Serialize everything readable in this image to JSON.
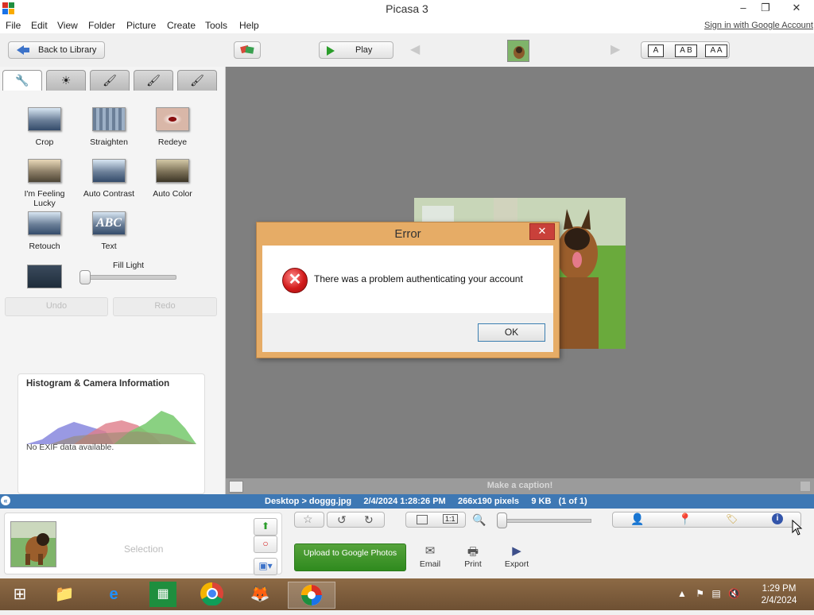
{
  "window": {
    "title": "Picasa 3",
    "minimize": "–",
    "maximize": "❐",
    "close": "✕"
  },
  "menu": {
    "items": [
      "File",
      "Edit",
      "View",
      "Folder",
      "Picture",
      "Create",
      "Tools",
      "Help"
    ],
    "signin": "Sign in with Google Account"
  },
  "toolbar": {
    "back_label": "Back to Library",
    "play_label": "Play",
    "caption_sizes": [
      "A",
      "A B",
      "A A"
    ]
  },
  "edit_panel": {
    "tools": [
      {
        "label": "Crop",
        "icon": "crop-icon"
      },
      {
        "label": "Straighten",
        "icon": "straighten-icon"
      },
      {
        "label": "Redeye",
        "icon": "redeye-icon"
      },
      {
        "label": "I'm Feeling Lucky",
        "icon": "lucky-icon"
      },
      {
        "label": "Auto Contrast",
        "icon": "contrast-icon"
      },
      {
        "label": "Auto Color",
        "icon": "color-icon"
      },
      {
        "label": "Retouch",
        "icon": "retouch-icon"
      },
      {
        "label": "Text",
        "icon": "text-icon"
      }
    ],
    "fill_light_label": "Fill Light",
    "fill_light_value": 0,
    "undo_label": "Undo",
    "redo_label": "Redo"
  },
  "histogram": {
    "title": "Histogram & Camera Information",
    "exif": "No EXIF data available."
  },
  "viewer": {
    "caption_placeholder": "Make a caption!"
  },
  "status": {
    "text": "Desktop > doggg.jpg     2/4/2024 1:28:26 PM     266x190 pixels     9 KB   (1 of 1)"
  },
  "tray": {
    "selection_label": "Selection",
    "upload_label": "Upload to Google Photos",
    "actions": [
      {
        "label": "Email",
        "icon": "email-icon"
      },
      {
        "label": "Print",
        "icon": "print-icon"
      },
      {
        "label": "Export",
        "icon": "export-icon"
      }
    ]
  },
  "dialog": {
    "title": "Error",
    "message": "There was a problem authenticating your account",
    "ok_label": "OK",
    "close": "✕"
  },
  "taskbar": {
    "time": "1:29 PM",
    "date": "2/4/2024"
  },
  "colors": {
    "status_bar": "#3e78b4",
    "upload_button": "#3b9528",
    "dialog_frame": "#e6ac66",
    "error_red": "#d21b1b"
  }
}
